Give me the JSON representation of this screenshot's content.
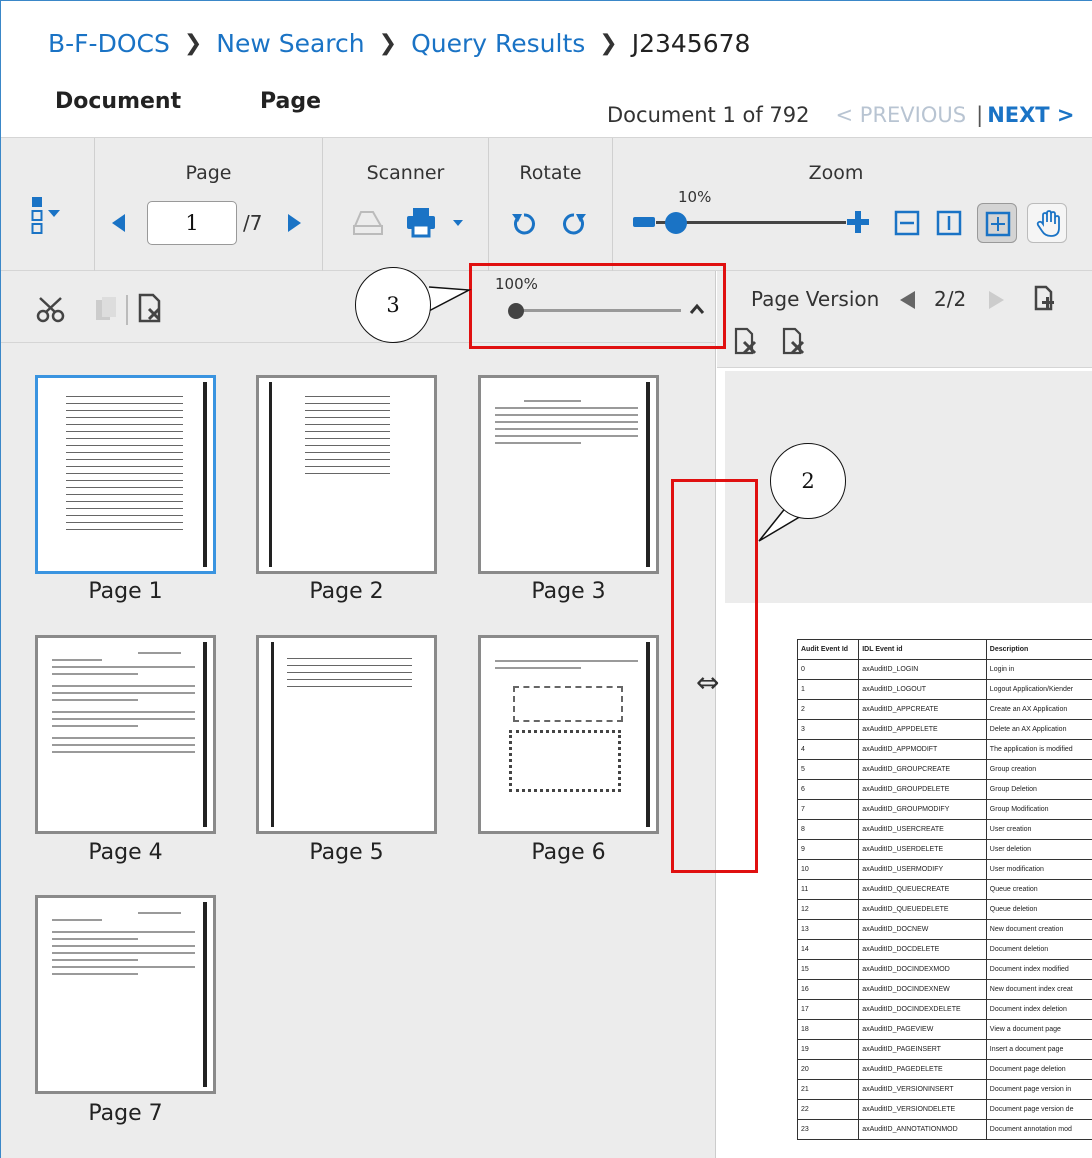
{
  "breadcrumb": {
    "items": [
      "B-F-DOCS",
      "New Search",
      "Query Results"
    ],
    "current": "J2345678"
  },
  "tabs": [
    "Document",
    "Page"
  ],
  "doc_nav": {
    "count": "Document 1 of 792",
    "prev": "< PREVIOUS",
    "separator": "|",
    "next": "NEXT >"
  },
  "toolbar": {
    "page_label": "Page",
    "page_value": "1",
    "page_total": "/7",
    "scanner_label": "Scanner",
    "rotate_label": "Rotate",
    "zoom_label": "Zoom",
    "zoom_value": "10%",
    "zoom_level": 0.1
  },
  "left_panel": {
    "thumb_size_value": "100%",
    "thumbnails": [
      "Page 1",
      "Page 2",
      "Page 3",
      "Page 4",
      "Page 5",
      "Page 6",
      "Page 7"
    ],
    "selected_index": 0
  },
  "right_panel": {
    "page_version_label": "Page Version",
    "page_version_count": "2/2"
  },
  "annotations": {
    "callout_2": "2",
    "callout_3": "3"
  },
  "audit_table": {
    "headers": [
      "Audit Event Id",
      "IDL Event id",
      "Description"
    ],
    "rows": [
      [
        "0",
        "axAuditID_LOGIN",
        "Login in"
      ],
      [
        "1",
        "axAuditID_LOGOUT",
        "Logout Application/Kiender"
      ],
      [
        "2",
        "axAuditID_APPCREATE",
        "Create an AX Application"
      ],
      [
        "3",
        "axAuditID_APPDELETE",
        "Delete an AX Application"
      ],
      [
        "4",
        "axAuditID_APPMODIFT",
        "The application is modified"
      ],
      [
        "5",
        "axAuditID_GROUPCREATE",
        "Group creation"
      ],
      [
        "6",
        "axAuditID_GROUPDELETE",
        "Group Deletion"
      ],
      [
        "7",
        "axAuditID_GROUPMODIFY",
        "Group Modification"
      ],
      [
        "8",
        "axAuditID_USERCREATE",
        "User creation"
      ],
      [
        "9",
        "axAuditID_USERDELETE",
        "User deletion"
      ],
      [
        "10",
        "axAuditID_USERMODIFY",
        "User modification"
      ],
      [
        "11",
        "axAuditID_QUEUECREATE",
        "Queue creation"
      ],
      [
        "12",
        "axAuditID_QUEUEDELETE",
        "Queue deletion"
      ],
      [
        "13",
        "axAuditID_DOCNEW",
        "New document creation"
      ],
      [
        "14",
        "axAuditID_DOCDELETE",
        "Document deletion"
      ],
      [
        "15",
        "axAuditID_DOCINDEXMOD",
        "Document index modified"
      ],
      [
        "16",
        "axAuditID_DOCINDEXNEW",
        "New document index creat"
      ],
      [
        "17",
        "axAuditID_DOCINDEXDELETE",
        "Document index deletion"
      ],
      [
        "18",
        "axAuditID_PAGEVIEW",
        "View a document page"
      ],
      [
        "19",
        "axAuditID_PAGEINSERT",
        "Insert a document page"
      ],
      [
        "20",
        "axAuditID_PAGEDELETE",
        "Document page deletion"
      ],
      [
        "21",
        "axAuditID_VERSIONINSERT",
        "Document page version in"
      ],
      [
        "22",
        "axAuditID_VERSIONDELETE",
        "Document page version de"
      ],
      [
        "23",
        "axAuditID_ANNOTATIONMOD",
        "Document annotation mod"
      ]
    ]
  },
  "colors": {
    "accent": "#1a73c5",
    "highlight": "#e01010",
    "selected_border": "#3a94e0"
  }
}
